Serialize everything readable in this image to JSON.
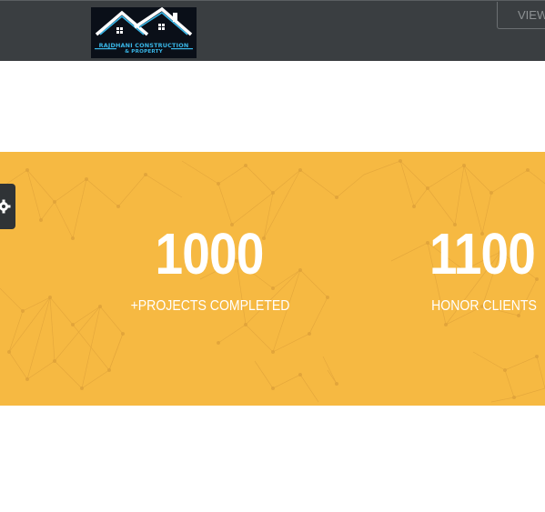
{
  "header": {
    "logo": {
      "line1": "RAJDHANI CONSTRUCTION",
      "line2": "& PROPERTY"
    },
    "view_button_label": "VIEW"
  },
  "stats": {
    "items": [
      {
        "value": "1000",
        "label": "+PROJECTS COMPLETED"
      },
      {
        "value": "1100",
        "label": "HONOR CLIENTS"
      }
    ]
  },
  "icons": {
    "settings_tab": "gear-icon",
    "logo_roof": "house-roof-icon"
  },
  "colors": {
    "header_bg": "#3a3e41",
    "stats_bg": "#f6b942",
    "logo_accent": "#39b7e8",
    "text": "#ffffff"
  }
}
